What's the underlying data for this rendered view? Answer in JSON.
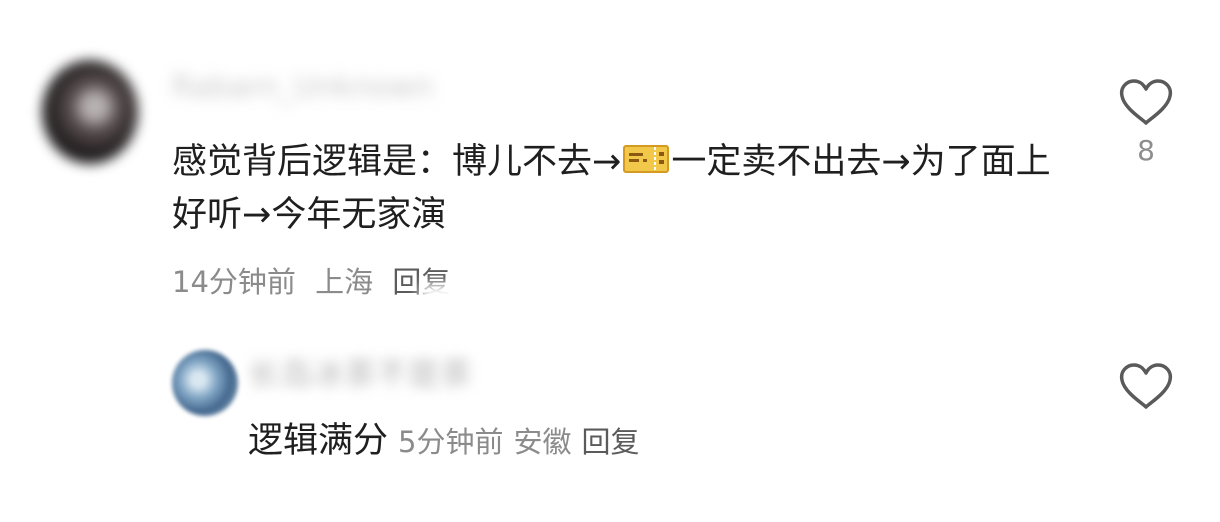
{
  "comment": {
    "username": "Rabarn_Unknown",
    "text": "感觉背后逻辑是：博儿不去→",
    "text_after_icon": "一定卖不出去→为了面上好听→今年无家演",
    "icon": "ticket-icon",
    "time": "14分钟前",
    "location": "上海",
    "reply_label": "回复",
    "likes": "8"
  },
  "reply": {
    "username": "长岛冰茶不是茶",
    "text": "逻辑满分",
    "time": "5分钟前",
    "location": "安徽",
    "reply_label": "回复"
  },
  "colors": {
    "text": "#1f1f1f",
    "meta": "#8b8b8b",
    "ticket": "#f2c84b"
  }
}
